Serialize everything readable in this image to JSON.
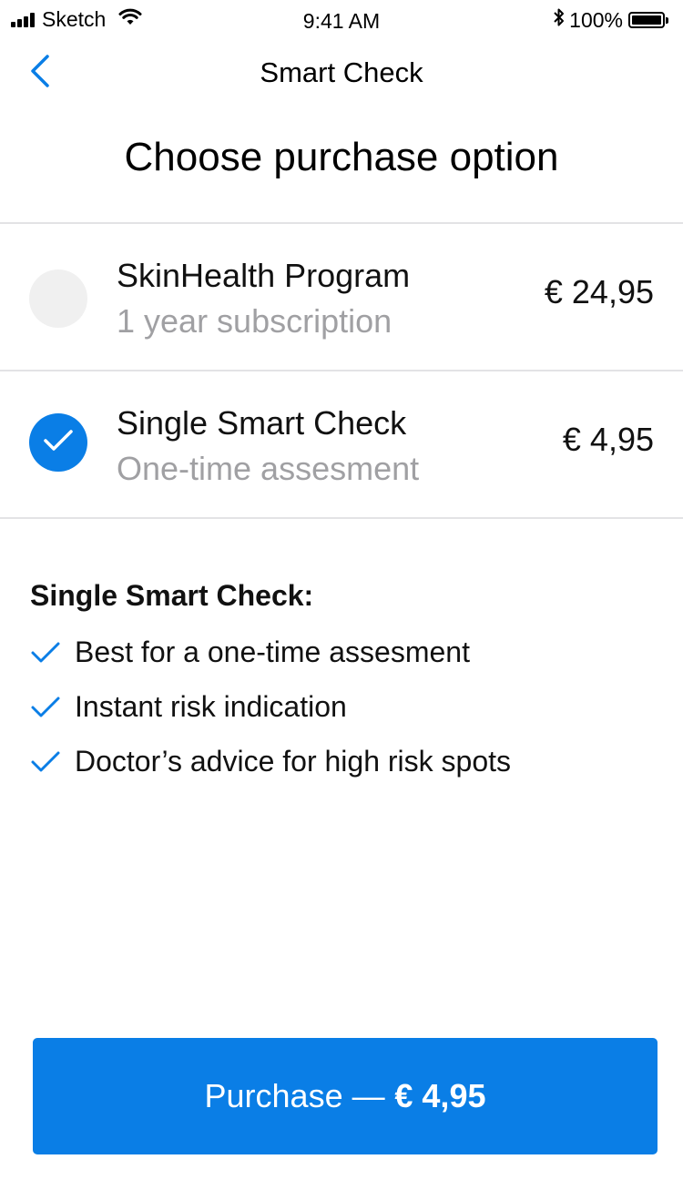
{
  "status_bar": {
    "carrier": "Sketch",
    "time": "9:41 AM",
    "battery": "100%"
  },
  "nav": {
    "title": "Smart Check",
    "back_icon": "chevron-left-icon"
  },
  "page_title": "Choose purchase option",
  "options": [
    {
      "title": "SkinHealth Program",
      "subtitle": "1 year subscription",
      "price": "€ 24,95",
      "selected": false
    },
    {
      "title": "Single Smart Check",
      "subtitle": "One-time assesment",
      "price": "€ 4,95",
      "selected": true
    }
  ],
  "features": {
    "heading": "Single Smart Check:",
    "items": [
      "Best for a one-time assesment",
      "Instant risk indication",
      "Doctor’s advice for high risk spots"
    ]
  },
  "purchase_button": {
    "label": "Purchase —",
    "amount": "€ 4,95"
  },
  "colors": {
    "accent": "#0a7ee6",
    "muted_text": "#a0a0a3",
    "divider": "#e3e3e5",
    "radio_off": "#f0f0f0"
  }
}
